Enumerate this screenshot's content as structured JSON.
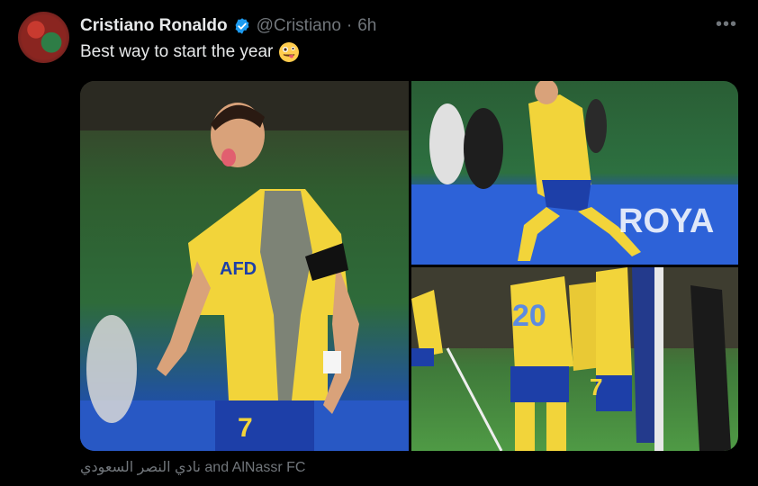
{
  "tweet": {
    "author_name": "Cristiano Ronaldo",
    "handle": "@Cristiano",
    "separator": "·",
    "time": "6h",
    "text": "Best way to start the year",
    "text_emoji": "zany-face-emoji",
    "more_label": "•••"
  },
  "media": {
    "tag_caption": "نادي النصر السعودي and AlNassr FC",
    "photo1_shirt_text": "AFD",
    "photo1_number": "7",
    "photo2_board_text": "ROYA",
    "photo3_number_left": "20",
    "photo3_number_right": "7"
  },
  "colors": {
    "verified_blue": "#1d9bf0",
    "kit_yellow": "#f2d43a",
    "kit_blue": "#1d3fa8"
  }
}
